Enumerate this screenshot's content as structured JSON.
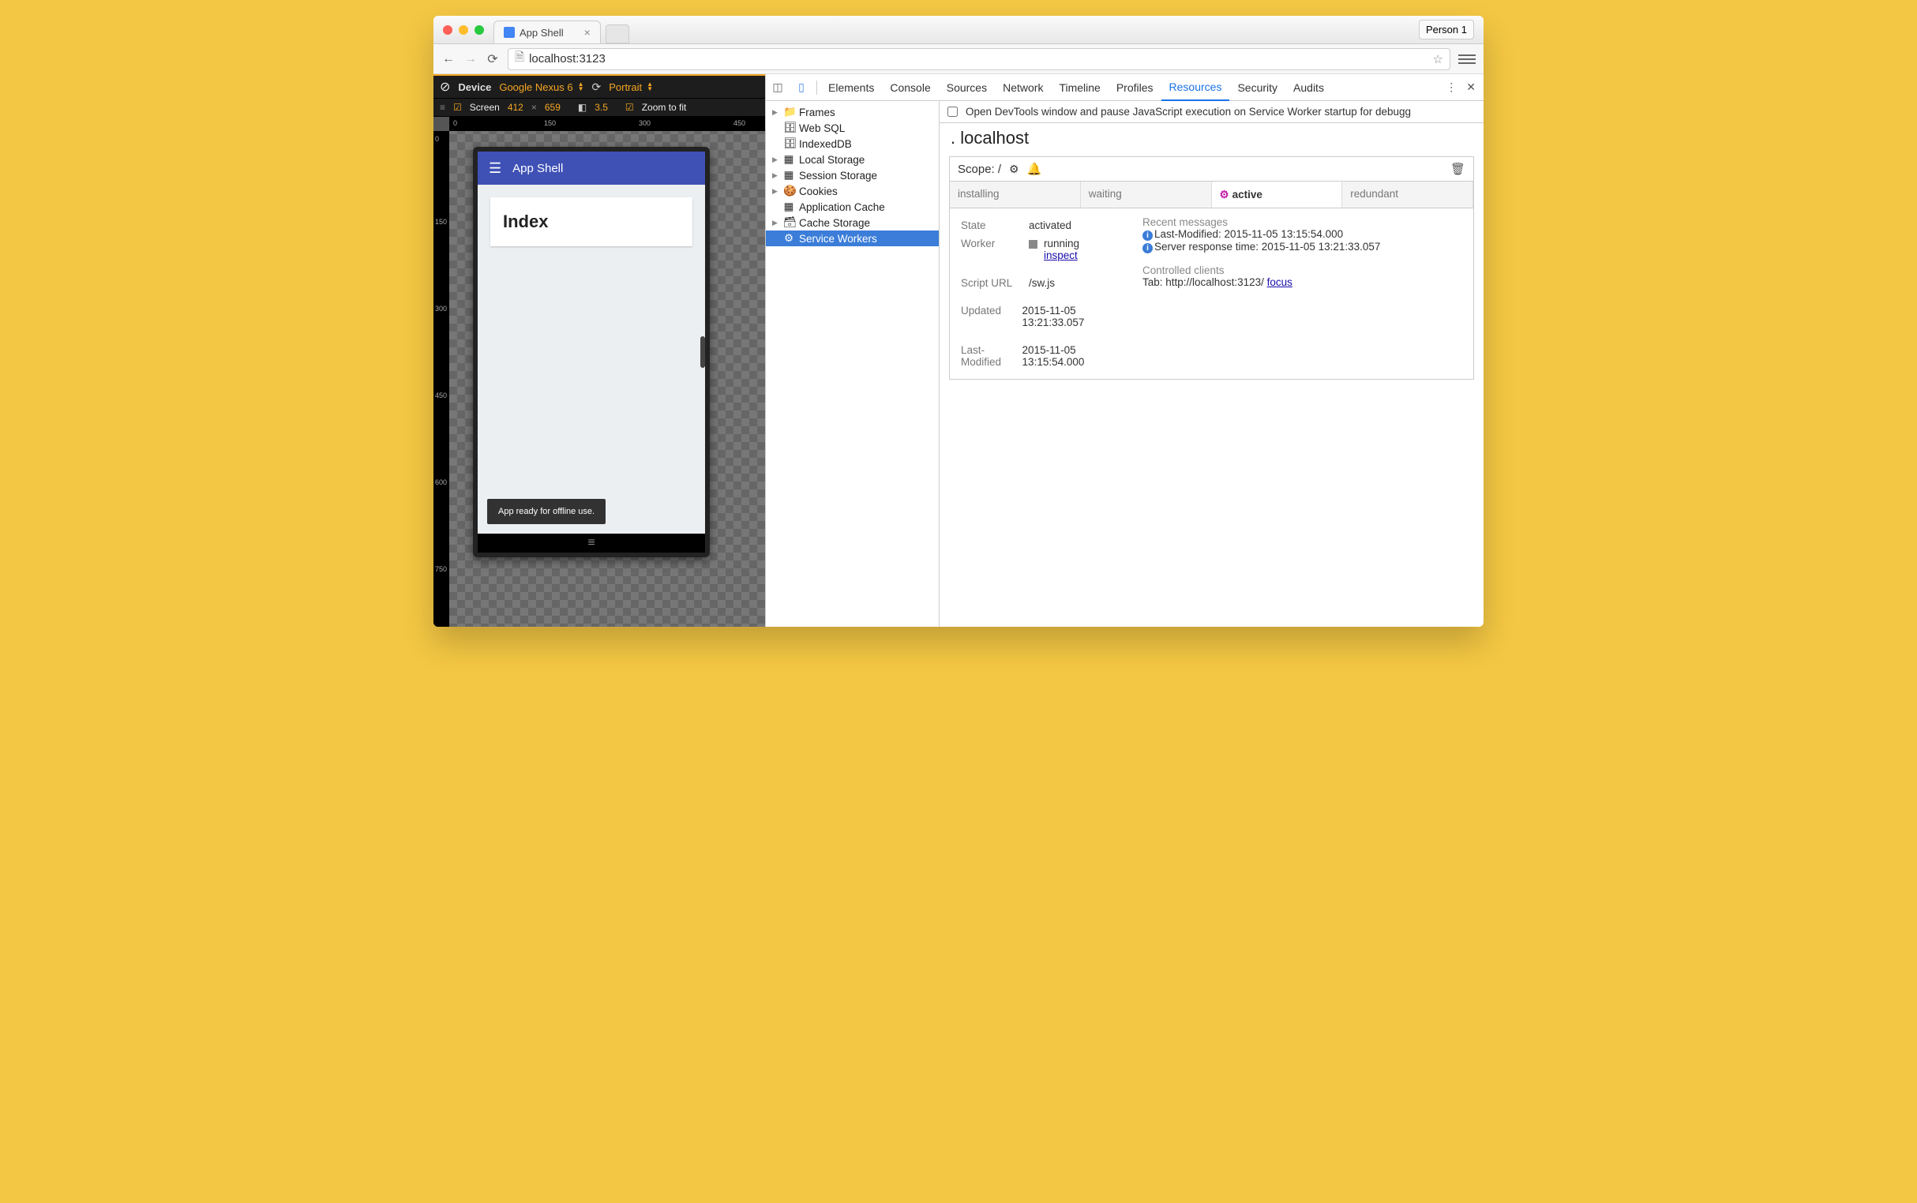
{
  "browser": {
    "tab_title": "App Shell",
    "person": "Person 1",
    "url_host": "localhost:",
    "url_port": "3123"
  },
  "device_toolbar": {
    "device_label": "Device",
    "device_name": "Google Nexus 6",
    "orientation": "Portrait",
    "screen_label": "Screen",
    "width": "412",
    "height": "659",
    "dpr": "3.5",
    "zoom_label": "Zoom to fit",
    "ruler_h": [
      "0",
      "150",
      "300",
      "450"
    ],
    "ruler_v": [
      "0",
      "150",
      "300",
      "450",
      "600",
      "750"
    ]
  },
  "app": {
    "title": "App Shell",
    "card_heading": "Index",
    "toast": "App ready for offline use."
  },
  "devtools": {
    "tabs": [
      "Elements",
      "Console",
      "Sources",
      "Network",
      "Timeline",
      "Profiles",
      "Resources",
      "Security",
      "Audits"
    ],
    "active_tab": "Resources",
    "pause_text": "Open DevTools window and pause JavaScript execution on Service Worker startup for debugg",
    "tree": [
      {
        "label": "Frames",
        "icon": "folder",
        "expand": true
      },
      {
        "label": "Web SQL",
        "icon": "db"
      },
      {
        "label": "IndexedDB",
        "icon": "db"
      },
      {
        "label": "Local Storage",
        "icon": "grid",
        "expand": true
      },
      {
        "label": "Session Storage",
        "icon": "grid",
        "expand": true
      },
      {
        "label": "Cookies",
        "icon": "cookie",
        "expand": true
      },
      {
        "label": "Application Cache",
        "icon": "grid"
      },
      {
        "label": "Cache Storage",
        "icon": "stack",
        "expand": true
      },
      {
        "label": "Service Workers",
        "icon": "gear",
        "selected": true
      }
    ],
    "panel": {
      "host": "localhost",
      "scope_label": "Scope: /",
      "status_tabs": [
        "installing",
        "waiting",
        "active",
        "redundant"
      ],
      "status_active": "active",
      "state_label": "State",
      "state": "activated",
      "worker_label": "Worker",
      "worker_status": "running",
      "worker_link": "inspect",
      "script_label": "Script URL",
      "script": "/sw.js",
      "updated_label": "Updated",
      "updated": "2015-11-05 13:21:33.057",
      "lastmod_label": "Last-Modified",
      "lastmod": "2015-11-05 13:15:54.000",
      "msgs_label": "Recent messages",
      "msg1": "Last-Modified: 2015-11-05 13:15:54.000",
      "msg2": "Server response time: 2015-11-05 13:21:33.057",
      "clients_label": "Controlled clients",
      "client_text": "Tab: http://localhost:3123/ ",
      "client_link": "focus"
    }
  }
}
